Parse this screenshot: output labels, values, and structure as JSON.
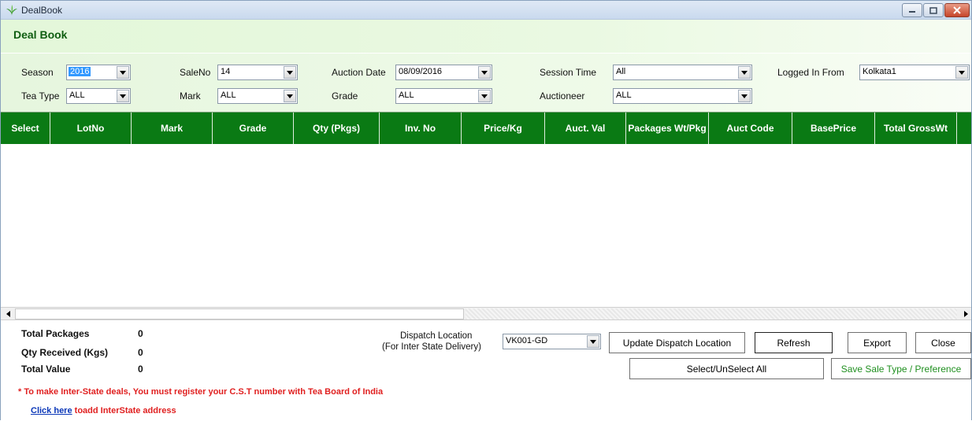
{
  "window": {
    "title": "DealBook"
  },
  "header": {
    "title": "Deal Book"
  },
  "filters": {
    "season": {
      "label": "Season",
      "value": "2016"
    },
    "sale_no": {
      "label": "SaleNo",
      "value": "14"
    },
    "auction_date": {
      "label": "Auction Date",
      "value": "08/09/2016"
    },
    "session_time": {
      "label": "Session Time",
      "value": "All"
    },
    "logged_in_from": {
      "label": "Logged In From",
      "value": "Kolkata1"
    },
    "tea_type": {
      "label": "Tea Type",
      "value": "ALL"
    },
    "mark": {
      "label": "Mark",
      "value": "ALL"
    },
    "grade": {
      "label": "Grade",
      "value": "ALL"
    },
    "auctioneer": {
      "label": "Auctioneer",
      "value": "ALL"
    }
  },
  "grid": {
    "columns": [
      "Select",
      "LotNo",
      "Mark",
      "Grade",
      "Qty (Pkgs)",
      "Inv. No",
      "Price/Kg",
      "Auct. Val",
      "Packages Wt/Pkg",
      "Auct Code",
      "BasePrice",
      "Total GrossWt"
    ],
    "rows": []
  },
  "summary": {
    "total_packages": {
      "label": "Total Packages",
      "value": "0"
    },
    "qty_received": {
      "label": "Qty Received (Kgs)",
      "value": "0"
    },
    "total_value": {
      "label": "Total Value",
      "value": "0"
    }
  },
  "dispatch": {
    "label_line1": "Dispatch Location",
    "label_line2": "(For Inter State Delivery)",
    "value": "VK001-GD"
  },
  "buttons": {
    "update_dispatch": "Update Dispatch Location",
    "refresh": "Refresh",
    "export": "Export",
    "close": "Close",
    "select_unselect_all": "Select/UnSelect All",
    "save_sale_type": "Save Sale Type / Preference"
  },
  "notice": {
    "text": "* To make Inter-State deals, You must register your C.S.T number with Tea Board of India",
    "link_text": "Click here",
    "link_suffix": " toadd InterState address"
  },
  "colors": {
    "grid_header": "#0a7a14",
    "accent_green": "#0f5d11",
    "warning_red": "#e02020",
    "link_blue": "#0a37b8"
  }
}
